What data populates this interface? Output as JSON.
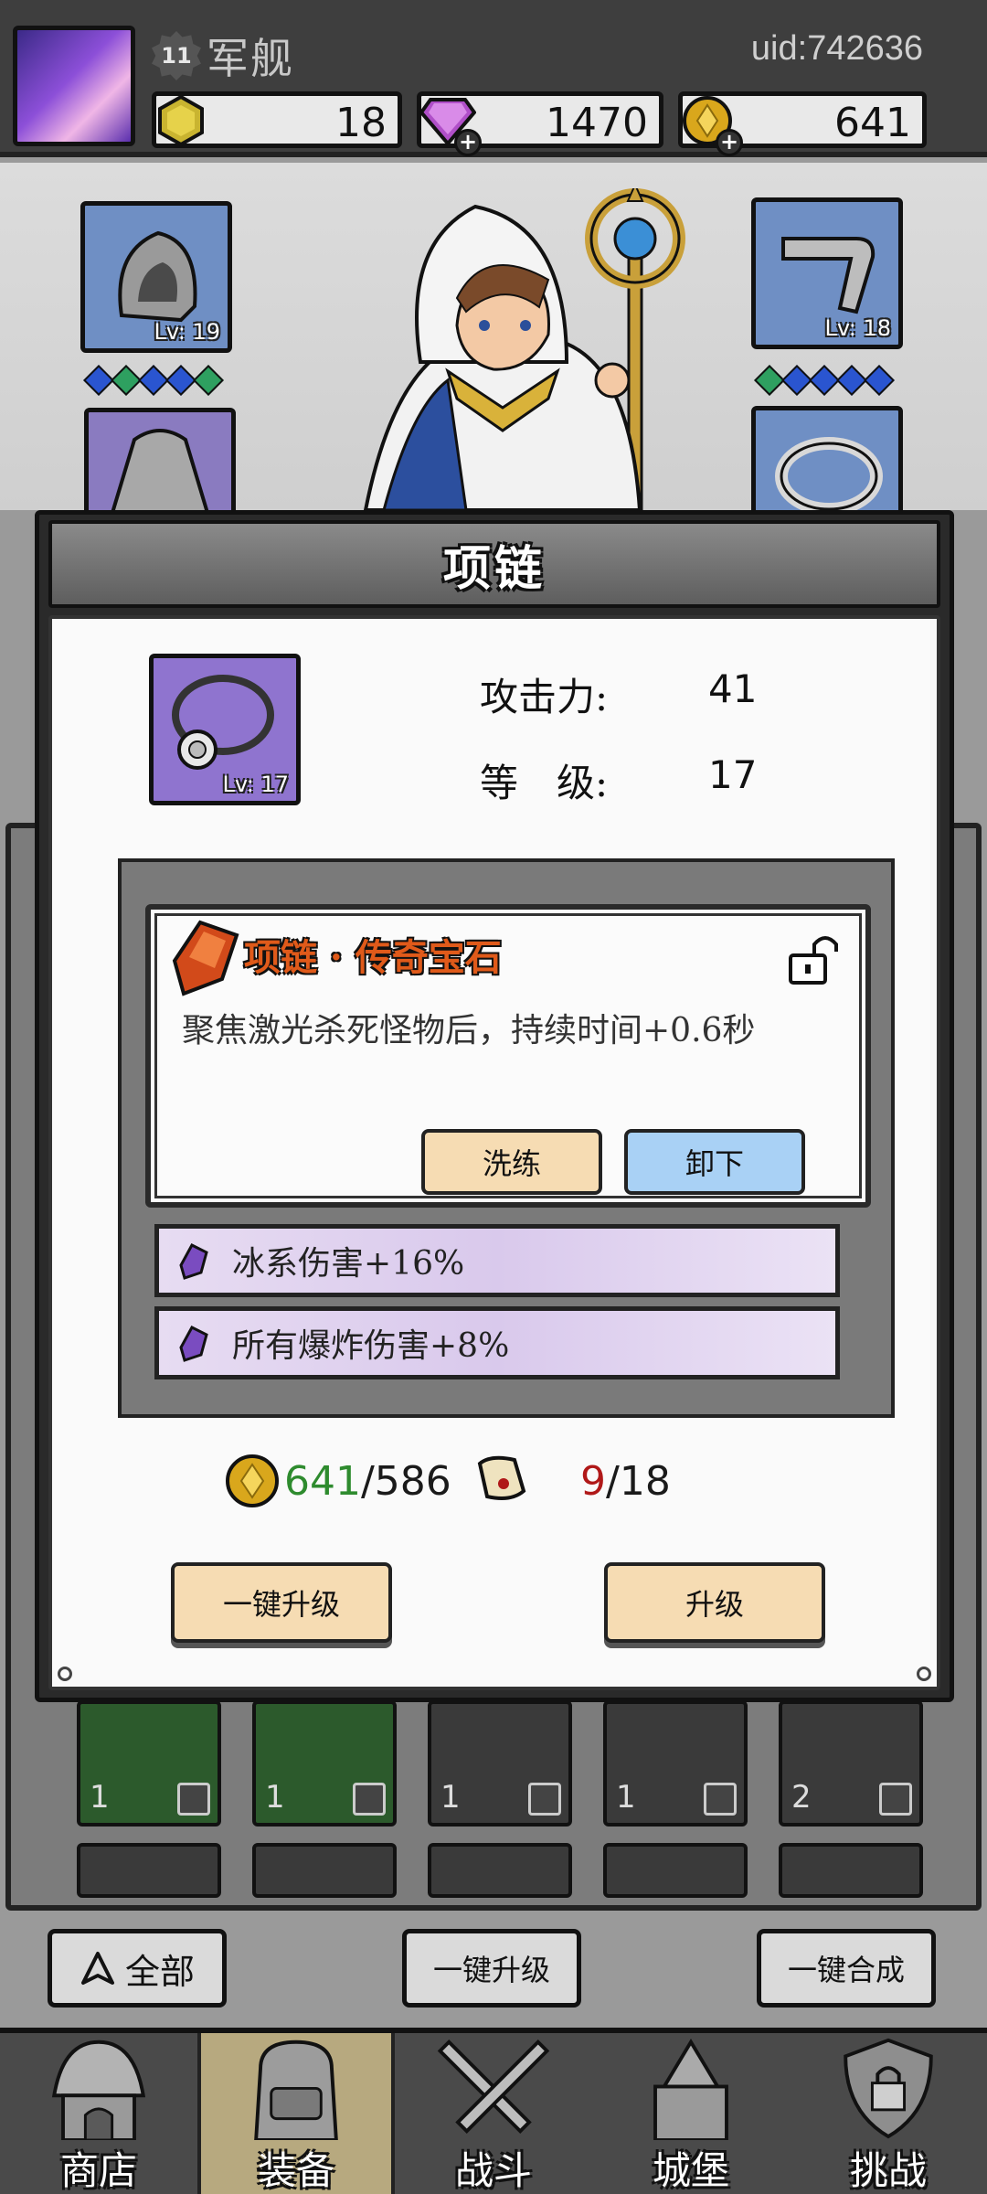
{
  "header": {
    "player_level": "11",
    "rank_title": "军舰",
    "uid": "uid:742636",
    "resources": [
      {
        "name": "stone",
        "icon": "hexagon-gem-icon",
        "value": "18",
        "color": "#c9b430"
      },
      {
        "name": "diamond",
        "icon": "diamond-icon",
        "value": "1470",
        "color": "#b04fc8"
      },
      {
        "name": "gold",
        "icon": "gold-coin-icon",
        "value": "641",
        "color": "#d9a71c"
      }
    ]
  },
  "equipment": {
    "left_top": {
      "icon": "hood-icon",
      "level": "Lv: 19"
    },
    "right_top": {
      "icon": "pipe-icon",
      "level": "Lv: 18"
    }
  },
  "inventory": {
    "row1": [
      {
        "count": "1",
        "kind": "green"
      },
      {
        "count": "1",
        "kind": "green"
      },
      {
        "count": "1",
        "kind": "grey"
      },
      {
        "count": "1",
        "kind": "grey"
      },
      {
        "count": "2",
        "kind": "grey"
      }
    ]
  },
  "actions": {
    "filter_all": "全部",
    "batch_upgrade": "一键升级",
    "batch_merge": "一键合成"
  },
  "nav": [
    {
      "label": "商店",
      "icon": "shop-hut-icon"
    },
    {
      "label": "装备",
      "icon": "backpack-icon"
    },
    {
      "label": "战斗",
      "icon": "crossed-swords-icon"
    },
    {
      "label": "城堡",
      "icon": "castle-icon"
    },
    {
      "label": "挑战",
      "icon": "locked-shield-icon"
    }
  ],
  "modal": {
    "title": "项链",
    "item": {
      "icon": "necklace-icon",
      "level": "Lv: 17"
    },
    "stats": [
      {
        "label": "攻击力:",
        "value": "41"
      },
      {
        "label": "等　级:",
        "value": "17"
      }
    ],
    "gem": {
      "name": "项链 · 传奇宝石",
      "description": "聚焦激光杀死怪物后，持续时间+0.6秒",
      "reforge_label": "洗练",
      "unequip_label": "卸下"
    },
    "affixes": [
      {
        "text": "冰系伤害+16%"
      },
      {
        "text": "所有爆炸伤害+8%"
      }
    ],
    "cost": {
      "gold_have": "641",
      "gold_need": "/586",
      "scroll_have": "9",
      "scroll_need": "/18"
    },
    "upgrade_all_label": "一键升级",
    "upgrade_label": "升级"
  },
  "colors": {
    "accent_orange": "#e05a1a",
    "button_cream": "#f6dcb3",
    "button_blue": "#a9d1f5",
    "ok_green": "#2e8b2e",
    "lack_red": "#b01818"
  }
}
